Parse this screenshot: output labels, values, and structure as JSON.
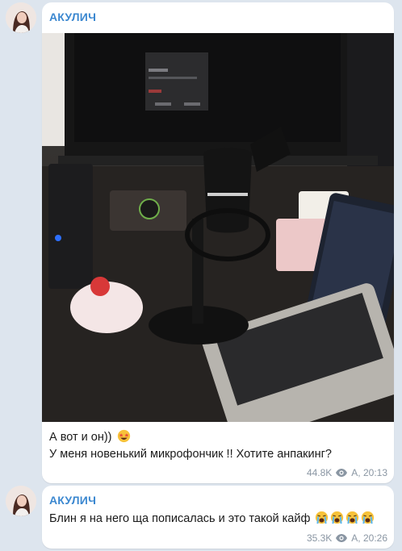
{
  "messages": [
    {
      "sender": "АКУЛИЧ",
      "line1": "А вот и он))",
      "line2": "У меня новенький микрофончик !! Хотите анпакинг?",
      "views": "44.8K",
      "author_time": "А, 20:13",
      "emojis": [
        "star-struck-emoji"
      ]
    },
    {
      "sender": "АКУЛИЧ",
      "line1": "Блин я на него ща пописалась и это такой кайф",
      "views": "35.3K",
      "author_time": "А, 20:26",
      "emojis": [
        "loudly-crying-emoji",
        "loudly-crying-emoji",
        "loudly-crying-emoji",
        "loudly-crying-emoji"
      ]
    }
  ],
  "colors": {
    "chat_background": "#dde5ee",
    "sender_name": "#3c88d0",
    "meta_text": "#8a96a3"
  }
}
